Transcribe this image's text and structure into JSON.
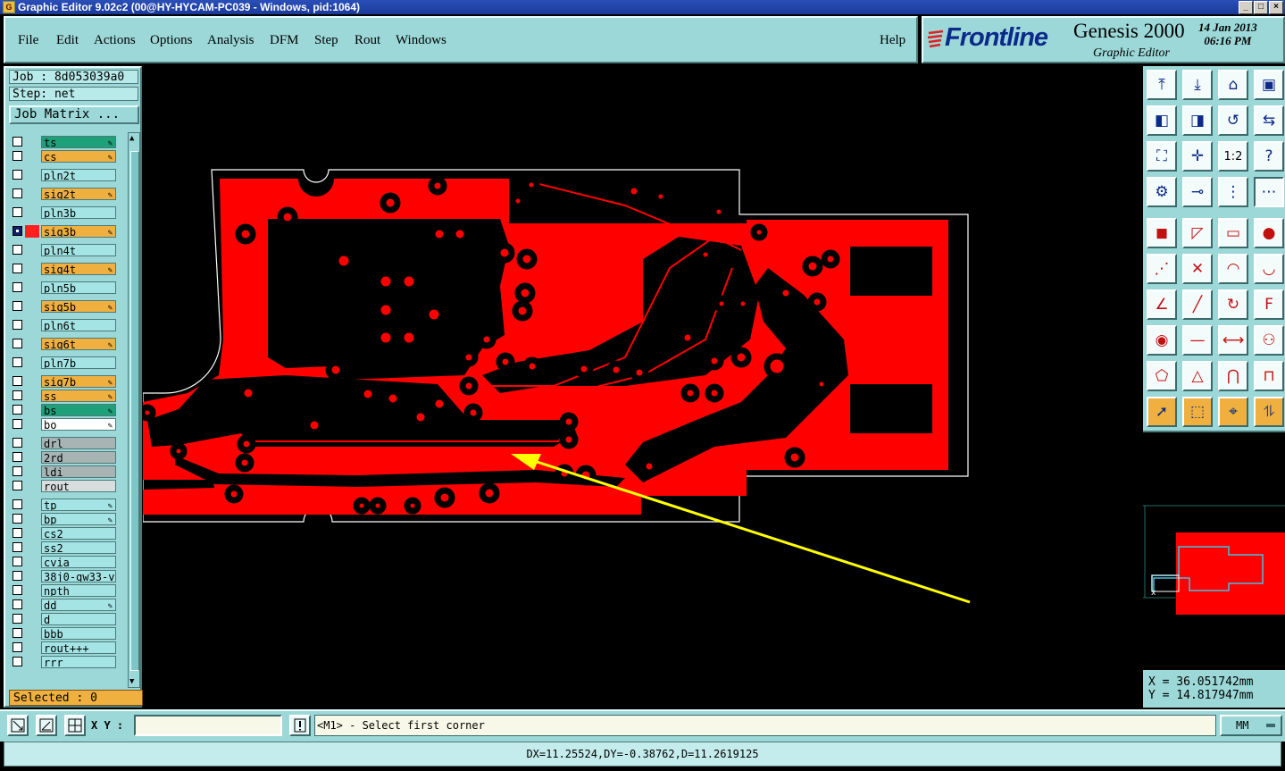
{
  "window": {
    "title": "Graphic Editor 9.02c2 (00@HY-HYCAM-PC039 - Windows, pid:1064)"
  },
  "menu": {
    "items": [
      "File",
      "Edit",
      "Actions",
      "Options",
      "Analysis",
      "DFM",
      "Step",
      "Rout",
      "Windows"
    ],
    "help": "Help"
  },
  "brand": {
    "logo": "Frontline",
    "product": "Genesis 2000",
    "subtitle": "Graphic Editor",
    "date": "14 Jan 2013",
    "time": "06:16 PM"
  },
  "job": {
    "label": "Job : 8d053039a0",
    "step": "Step: net",
    "matrix_button": "Job Matrix ..."
  },
  "layers": [
    {
      "name": "ts",
      "color": "#1ea078",
      "affected": true
    },
    {
      "name": "cs",
      "color": "#f0b040",
      "affected": true
    },
    {
      "name": "pln2t",
      "color": "#a4e4e4"
    },
    {
      "name": "sig2t",
      "color": "#f0b040",
      "affected": true
    },
    {
      "name": "pln3b",
      "color": "#a4e4e4"
    },
    {
      "name": "sig3b",
      "color": "#f0b040",
      "affected": true,
      "work": true
    },
    {
      "name": "pln4t",
      "color": "#a4e4e4"
    },
    {
      "name": "sig4t",
      "color": "#f0b040",
      "affected": true
    },
    {
      "name": "pln5b",
      "color": "#a4e4e4"
    },
    {
      "name": "sig5b",
      "color": "#f0b040",
      "affected": true
    },
    {
      "name": "pln6t",
      "color": "#a4e4e4"
    },
    {
      "name": "sig6t",
      "color": "#f0b040",
      "affected": true
    },
    {
      "name": "pln7b",
      "color": "#a4e4e4"
    },
    {
      "name": "sig7b",
      "color": "#f0b040",
      "affected": true
    },
    {
      "name": "ss",
      "color": "#f0b040",
      "affected": true
    },
    {
      "name": "bs",
      "color": "#1ea078",
      "affected": true
    },
    {
      "name": "bo",
      "color": "#ffffff",
      "affected": true
    },
    {
      "name": "drl",
      "color": "#a8b4b4"
    },
    {
      "name": "2rd",
      "color": "#a8b4b4"
    },
    {
      "name": "ldi",
      "color": "#a8b4b4"
    },
    {
      "name": "rout",
      "color": "#d8dede"
    },
    {
      "name": "tp",
      "color": "#a4e4e4",
      "affected": true
    },
    {
      "name": "bp",
      "color": "#a4e4e4",
      "affected": true
    },
    {
      "name": "cs2",
      "color": "#a4e4e4"
    },
    {
      "name": "ss2",
      "color": "#a4e4e4"
    },
    {
      "name": "cvia",
      "color": "#a4e4e4"
    },
    {
      "name": "38j0-gw33-v",
      "color": "#a4e4e4"
    },
    {
      "name": "npth",
      "color": "#a4e4e4"
    },
    {
      "name": "dd",
      "color": "#a4e4e4",
      "affected": true
    },
    {
      "name": "d",
      "color": "#a4e4e4"
    },
    {
      "name": "bbb",
      "color": "#a4e4e4"
    },
    {
      "name": "rout+++",
      "color": "#a4e4e4"
    },
    {
      "name": "rrr",
      "color": "#a4e4e4"
    }
  ],
  "selected": "Selected : 0",
  "canvas": {
    "copper_color": "#ff0000",
    "arrow_color": "#ffff00"
  },
  "toolbar_icons": [
    "open-job-icon",
    "save-icon",
    "home-icon",
    "window-icon",
    "move-left-icon",
    "move-right-icon",
    "rotate-icon",
    "mirror-icon",
    "fit-icon",
    "center-icon",
    "zoom-ratio-icon",
    "help-icon",
    "tools-icon",
    "measure-icon",
    "snap-grid-icon",
    "snap-pad-icon",
    "pad-icon",
    "line-icon",
    "ruler-icon",
    "fill-icon",
    "connect-icon",
    "cross-icon",
    "arc-icon",
    "arc-cw-icon",
    "angle-icon",
    "slash-icon",
    "rotate-cw-icon",
    "text-icon",
    "node-icon",
    "dash-icon",
    "dimension-icon",
    "circles-icon",
    "polygon-icon",
    "triangle-icon",
    "arch-icon",
    "bridge-icon",
    "select-icon",
    "select-box-icon",
    "select-net-icon",
    "route-icon"
  ],
  "zoom_ratio": "1:2",
  "coords": {
    "x": "X = 36.051742mm",
    "y": "Y = 14.817947mm"
  },
  "xy": {
    "label": "X Y :",
    "value": ""
  },
  "prompt": "<M1> - Select first corner",
  "units": "MM",
  "status": "DX=11.25524,DY=-0.38762,D=11.2619125"
}
